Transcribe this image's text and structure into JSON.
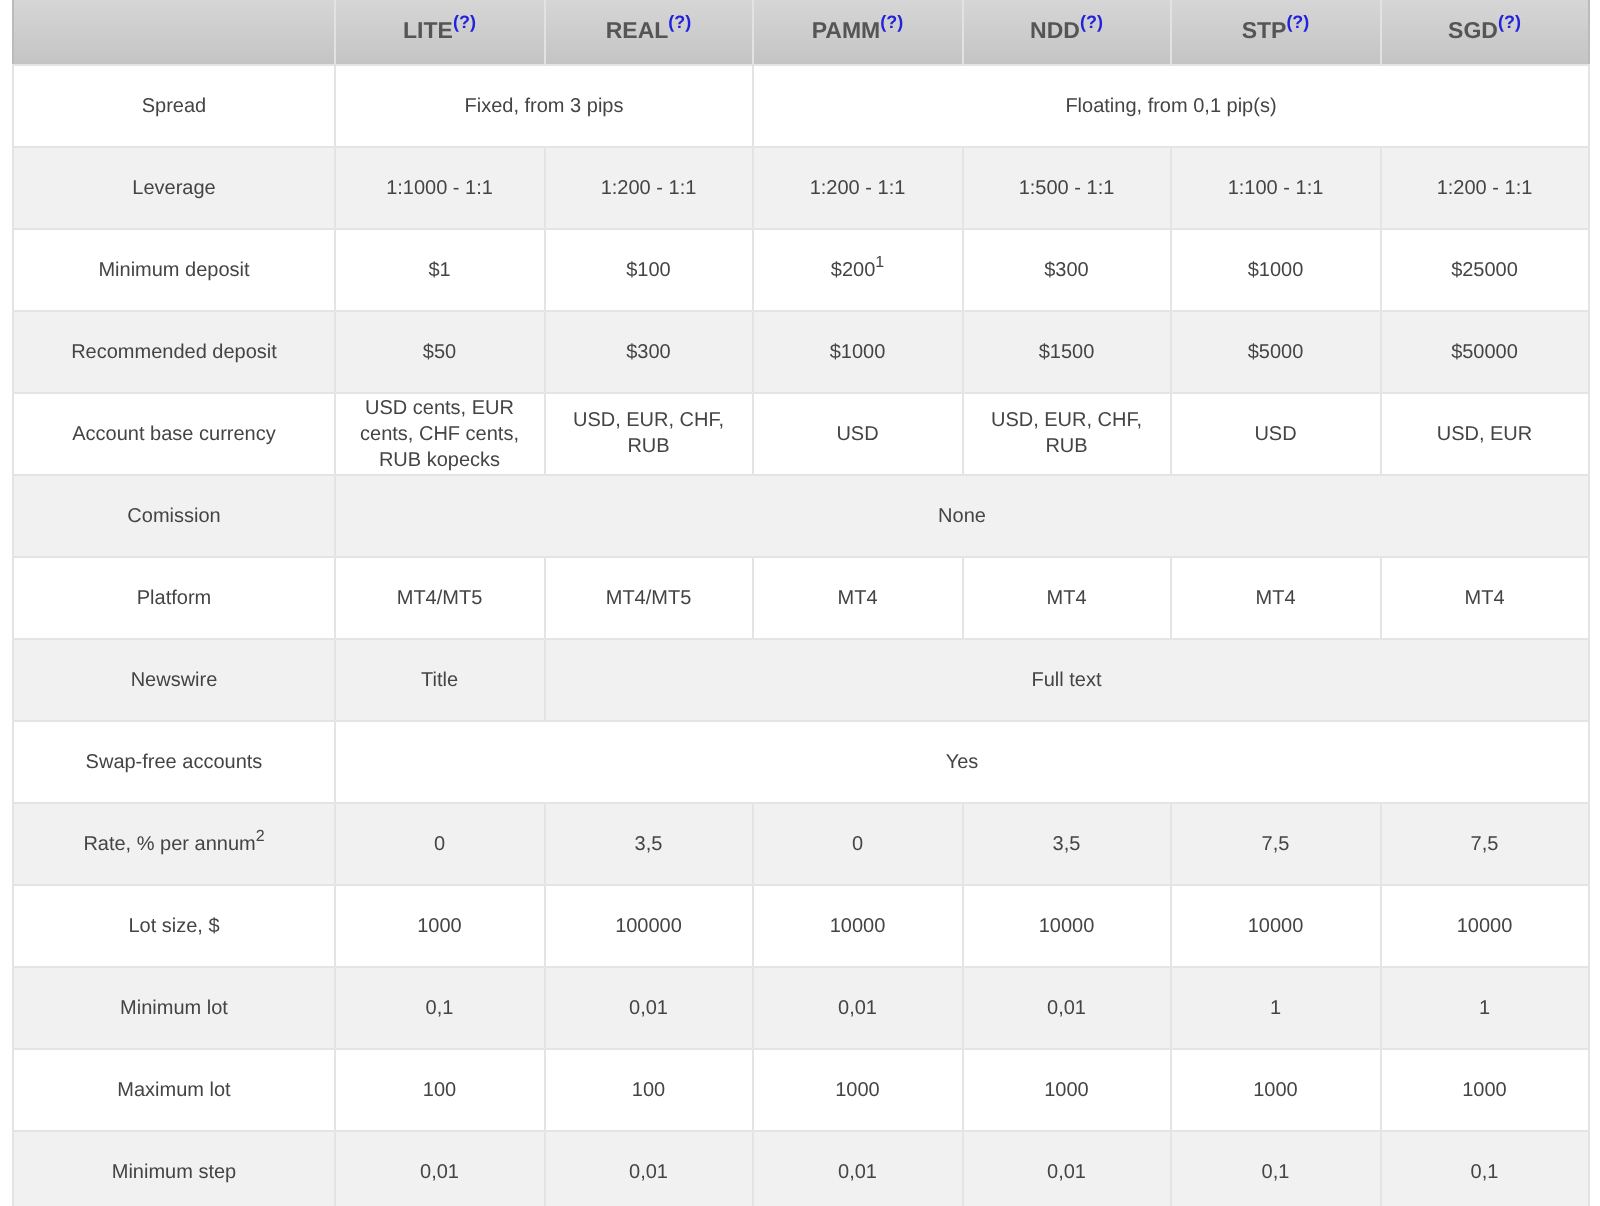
{
  "table": {
    "columns": [
      {
        "name": "LITE",
        "help": "(?)"
      },
      {
        "name": "REAL",
        "help": "(?)"
      },
      {
        "name": "PAMM",
        "help": "(?)"
      },
      {
        "name": "NDD",
        "help": "(?)"
      },
      {
        "name": "STP",
        "help": "(?)"
      },
      {
        "name": "SGD",
        "help": "(?)"
      }
    ],
    "rows": [
      {
        "label": "Spread",
        "cells": [
          {
            "text": "Fixed, from 3 pips",
            "colspan": 2
          },
          {
            "text": "Floating, from 0,1 pip(s)",
            "colspan": 4
          }
        ]
      },
      {
        "label": "Leverage",
        "cells": [
          {
            "text": "1:1000 - 1:1"
          },
          {
            "text": "1:200 - 1:1"
          },
          {
            "text": "1:200 - 1:1"
          },
          {
            "text": "1:500 - 1:1"
          },
          {
            "text": "1:100 - 1:1"
          },
          {
            "text": "1:200 - 1:1"
          }
        ]
      },
      {
        "label": "Minimum deposit",
        "cells": [
          {
            "text": "$1"
          },
          {
            "text": "$100"
          },
          {
            "text": "$200$^{1}$"
          },
          {
            "text": "$300"
          },
          {
            "text": "$1000"
          },
          {
            "text": "$25000"
          }
        ]
      },
      {
        "label": "Recommended deposit",
        "cells": [
          {
            "text": "$50"
          },
          {
            "text": "$300"
          },
          {
            "text": "$1000"
          },
          {
            "text": "$1500"
          },
          {
            "text": "$5000"
          },
          {
            "text": "$50000"
          }
        ]
      },
      {
        "label": "Account base currency",
        "cells": [
          {
            "text": "USD cents, EUR cents, CHF cents, RUB kopecks"
          },
          {
            "text": "USD, EUR, CHF, RUB"
          },
          {
            "text": "USD"
          },
          {
            "text": "USD, EUR, CHF, RUB"
          },
          {
            "text": "USD"
          },
          {
            "text": "USD, EUR"
          }
        ]
      },
      {
        "label": "Comission",
        "cells": [
          {
            "text": "None",
            "colspan": 6
          }
        ]
      },
      {
        "label": "Platform",
        "cells": [
          {
            "text": "MT4/MT5"
          },
          {
            "text": "MT4/MT5"
          },
          {
            "text": "MT4"
          },
          {
            "text": "MT4"
          },
          {
            "text": "MT4"
          },
          {
            "text": "MT4"
          }
        ]
      },
      {
        "label": "Newswire",
        "cells": [
          {
            "text": "Title"
          },
          {
            "text": "Full text",
            "colspan": 5
          }
        ]
      },
      {
        "label": "Swap-free accounts",
        "cells": [
          {
            "text": "Yes",
            "colspan": 6
          }
        ]
      },
      {
        "label": "Rate, % per annum$^{2}$",
        "cells": [
          {
            "text": "0"
          },
          {
            "text": "3,5"
          },
          {
            "text": "0"
          },
          {
            "text": "3,5"
          },
          {
            "text": "7,5"
          },
          {
            "text": "7,5"
          }
        ]
      },
      {
        "label": "Lot size, $",
        "cells": [
          {
            "text": "1000"
          },
          {
            "text": "100000"
          },
          {
            "text": "10000"
          },
          {
            "text": "10000"
          },
          {
            "text": "10000"
          },
          {
            "text": "10000"
          }
        ]
      },
      {
        "label": "Minimum lot",
        "cells": [
          {
            "text": "0,1"
          },
          {
            "text": "0,01"
          },
          {
            "text": "0,01"
          },
          {
            "text": "0,01"
          },
          {
            "text": "1"
          },
          {
            "text": "1"
          }
        ]
      },
      {
        "label": "Maximum lot",
        "cells": [
          {
            "text": "100"
          },
          {
            "text": "100"
          },
          {
            "text": "1000"
          },
          {
            "text": "1000"
          },
          {
            "text": "1000"
          },
          {
            "text": "1000"
          }
        ]
      },
      {
        "label": "Minimum step",
        "cells": [
          {
            "text": "0,01"
          },
          {
            "text": "0,01"
          },
          {
            "text": "0,01"
          },
          {
            "text": "0,01"
          },
          {
            "text": "0,1"
          },
          {
            "text": "0,1"
          }
        ]
      }
    ]
  }
}
